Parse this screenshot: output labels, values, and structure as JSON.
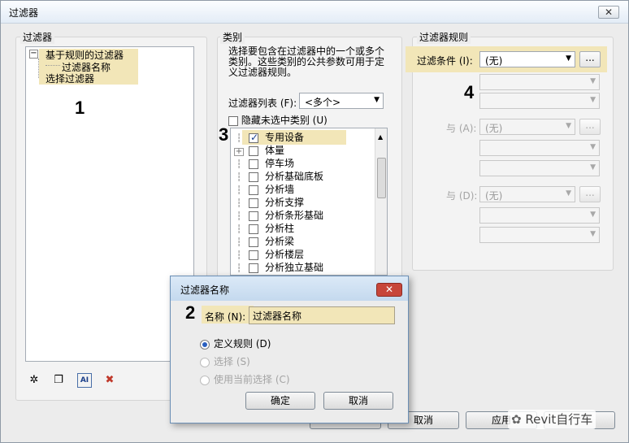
{
  "window": {
    "title": "过滤器",
    "close_glyph": "✕"
  },
  "filters_panel": {
    "title": "过滤器",
    "tree": {
      "root_rule": "基于规则的过滤器",
      "child": "过滤器名称",
      "root_select": "选择过滤器",
      "expand_glyph": "−"
    },
    "annotation": "1",
    "tool_icons": [
      "new-filter-icon",
      "duplicate-filter-icon",
      "rename-filter-icon",
      "delete-filter-icon"
    ]
  },
  "categories_panel": {
    "title": "类别",
    "description": "选择要包含在过滤器中的一个或多个类别。这些类别的公共参数可用于定义过滤器规则。",
    "filter_list_label": "过滤器列表 (F):",
    "filter_list_value": "<多个>",
    "hide_unchecked_label": "隐藏未选中类别 (U)",
    "annotation": "3",
    "items": [
      {
        "label": "专用设备",
        "checked": true,
        "expand": ""
      },
      {
        "label": "体量",
        "checked": false,
        "expand": "+"
      },
      {
        "label": "停车场",
        "checked": false,
        "expand": ""
      },
      {
        "label": "分析基础底板",
        "checked": false,
        "expand": ""
      },
      {
        "label": "分析墙",
        "checked": false,
        "expand": ""
      },
      {
        "label": "分析支撑",
        "checked": false,
        "expand": ""
      },
      {
        "label": "分析条形基础",
        "checked": false,
        "expand": ""
      },
      {
        "label": "分析柱",
        "checked": false,
        "expand": ""
      },
      {
        "label": "分析梁",
        "checked": false,
        "expand": ""
      },
      {
        "label": "分析楼层",
        "checked": false,
        "expand": ""
      },
      {
        "label": "分析独立基础",
        "checked": false,
        "expand": ""
      }
    ]
  },
  "rules_panel": {
    "title": "过滤器规则",
    "filter_condition_label": "过滤条件 (I):",
    "filter_condition_value": "(无)",
    "and_label_1": "与 (A):",
    "and_value_1": "(无)",
    "and_label_2": "与 (D):",
    "and_value_2": "(无)",
    "ellipsis": "...",
    "annotation": "4"
  },
  "bottom_buttons": {
    "cancel": "取消",
    "apply": "应用"
  },
  "watermark": "Revit自行车",
  "name_dialog": {
    "title": "过滤器名称",
    "close_glyph": "✕",
    "annotation": "2",
    "name_label": "名称 (N):",
    "name_value": "过滤器名称",
    "options": [
      {
        "label": "定义规则 (D)",
        "selected": true,
        "enabled": true
      },
      {
        "label": "选择 (S)",
        "selected": false,
        "enabled": false
      },
      {
        "label": "使用当前选择 (C)",
        "selected": false,
        "enabled": false
      }
    ],
    "ok": "确定",
    "cancel": "取消"
  }
}
